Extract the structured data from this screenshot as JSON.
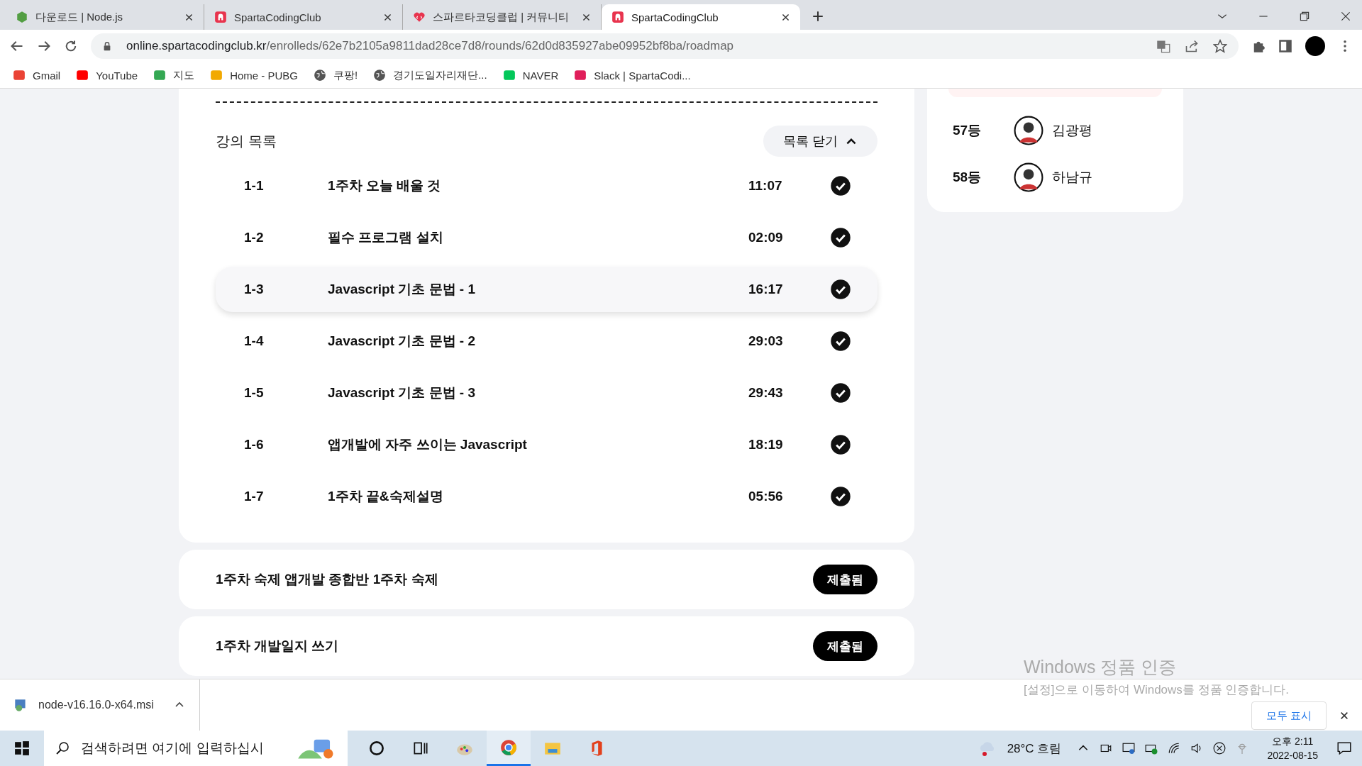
{
  "browser": {
    "tabs": [
      {
        "title": "다운로드 | Node.js",
        "kind": "node",
        "selected": false
      },
      {
        "title": "SpartaCodingClub",
        "kind": "sparta",
        "selected": false
      },
      {
        "title": "스파르타코딩클럽 | 커뮤니티",
        "kind": "community",
        "selected": false
      },
      {
        "title": "SpartaCodingClub",
        "kind": "sparta",
        "selected": true
      }
    ],
    "url_host": "online.spartacodingclub.kr",
    "url_path": "/enrolleds/62e7b2105a9811dad28ce7d8/rounds/62d0d835927abe09952bf8ba/roadmap",
    "bookmarks": [
      {
        "label": "Gmail",
        "kind": "gmail"
      },
      {
        "label": "YouTube",
        "kind": "youtube"
      },
      {
        "label": "지도",
        "kind": "maps"
      },
      {
        "label": "Home - PUBG",
        "kind": "pubg"
      },
      {
        "label": "쿠팡!",
        "kind": "globe"
      },
      {
        "label": "경기도일자리재단...",
        "kind": "globe"
      },
      {
        "label": "NAVER",
        "kind": "naver"
      },
      {
        "label": "Slack | SpartaCodi...",
        "kind": "slack"
      }
    ]
  },
  "lecture_list": {
    "title": "강의 목록",
    "toggle_button": "목록 닫기",
    "lessons": [
      {
        "number": "1-1",
        "title": "1주차 오늘 배울 것",
        "duration": "11:07",
        "completed": true,
        "selected": false
      },
      {
        "number": "1-2",
        "title": "필수 프로그램 설치",
        "duration": "02:09",
        "completed": true,
        "selected": false
      },
      {
        "number": "1-3",
        "title": "Javascript 기초 문법 - 1",
        "duration": "16:17",
        "completed": true,
        "selected": true
      },
      {
        "number": "1-4",
        "title": "Javascript 기초 문법 - 2",
        "duration": "29:03",
        "completed": true,
        "selected": false
      },
      {
        "number": "1-5",
        "title": "Javascript 기초 문법 - 3",
        "duration": "29:43",
        "completed": true,
        "selected": false
      },
      {
        "number": "1-6",
        "title": "앱개발에 자주 쓰이는 Javascript",
        "duration": "18:19",
        "completed": true,
        "selected": false
      },
      {
        "number": "1-7",
        "title": "1주차 끝&숙제설명",
        "duration": "05:56",
        "completed": true,
        "selected": false
      }
    ]
  },
  "assignments": [
    {
      "title": "1주차 숙제 앱개발 종합반 1주차 숙제",
      "status": "제출됨"
    },
    {
      "title": "1주차 개발일지 쓰기",
      "status": "제출됨"
    }
  ],
  "ranking": [
    {
      "rank": "57등",
      "name": "김광평"
    },
    {
      "rank": "58등",
      "name": "하남규"
    }
  ],
  "download_bar": {
    "file": "node-v16.16.0-x64.msi",
    "show_all": "모두 표시"
  },
  "activation_notice": {
    "title": "Windows 정품 인증",
    "message": "[설정]으로 이동하여 Windows를 정품 인증합니다."
  },
  "taskbar": {
    "search_placeholder": "검색하려면 여기에 입력하십시",
    "apps": [
      {
        "kind": "cortana",
        "selected": false
      },
      {
        "kind": "taskview",
        "selected": false
      },
      {
        "kind": "paint",
        "selected": false
      },
      {
        "kind": "chrome",
        "selected": true
      },
      {
        "kind": "explorer",
        "selected": false
      },
      {
        "kind": "office",
        "selected": false
      }
    ],
    "weather": "28°C 흐림",
    "time": "오후 2:11",
    "date": "2022-08-15"
  }
}
